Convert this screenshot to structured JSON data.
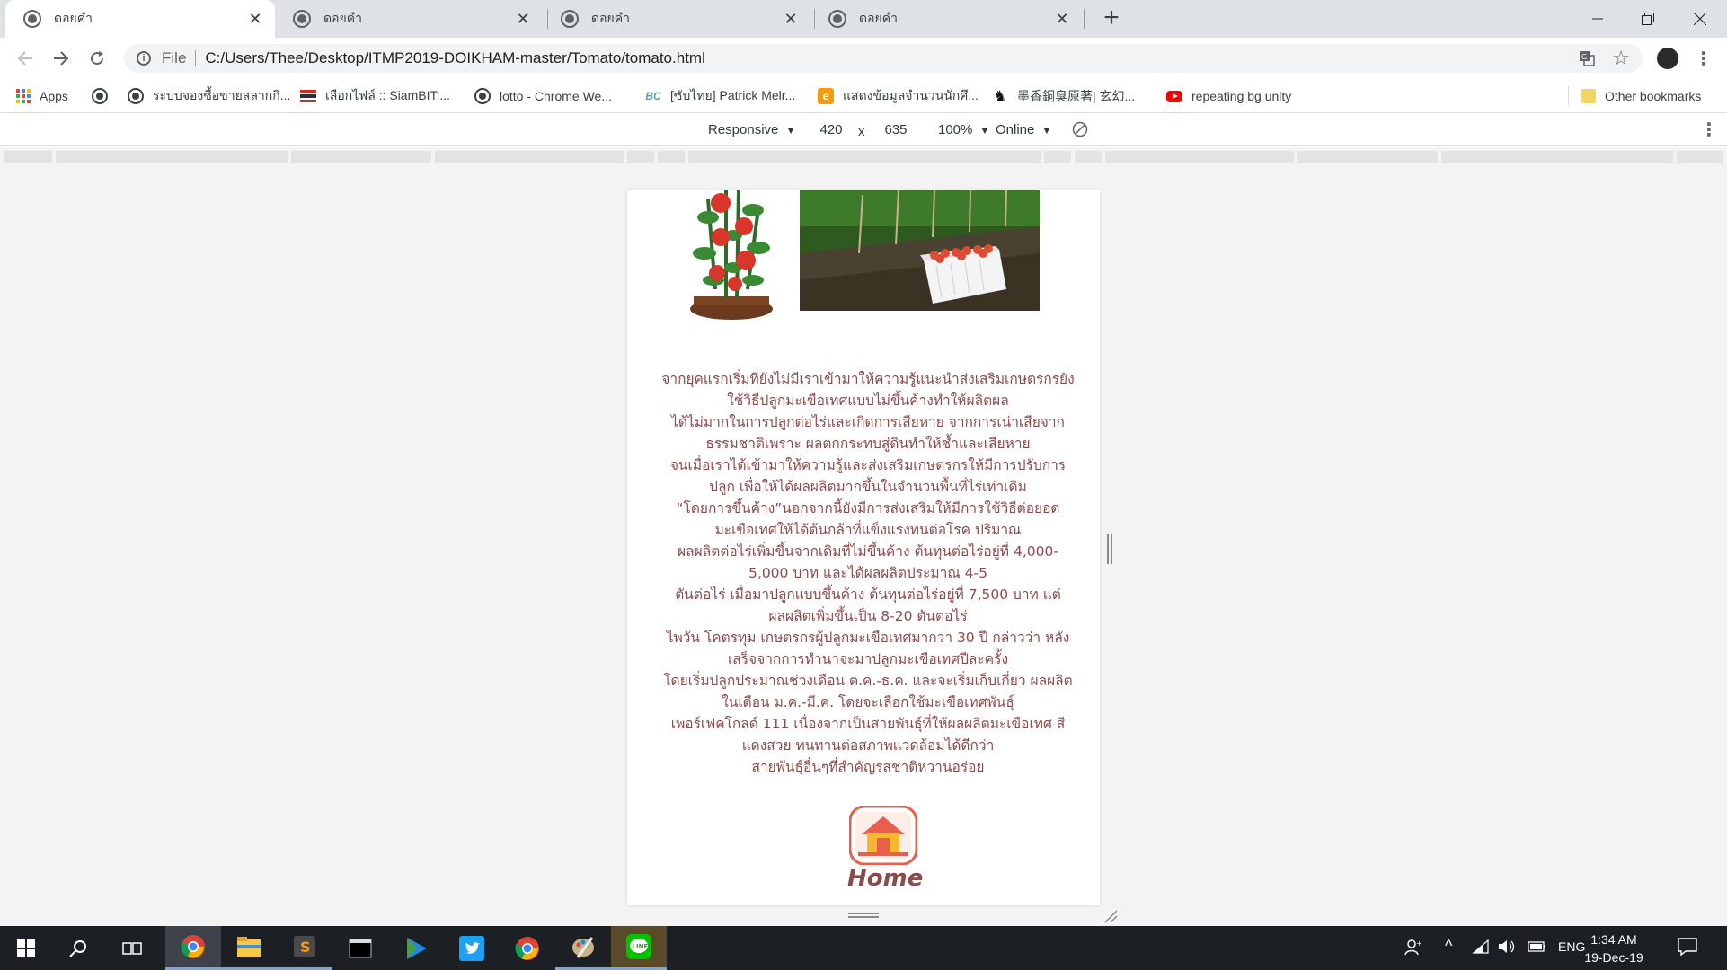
{
  "browser": {
    "tabs": [
      {
        "title": "ดอยคำ",
        "active": true
      },
      {
        "title": "ดอยคำ",
        "active": false
      },
      {
        "title": "ดอยคำ",
        "active": false
      },
      {
        "title": "ดอยคำ",
        "active": false
      }
    ],
    "address": {
      "scheme_label": "File",
      "url": "C:/Users/Thee/Desktop/ITMP2019-DOIKHAM-master/Tomato/tomato.html"
    }
  },
  "bookmarks": {
    "items": [
      {
        "label": "Apps",
        "icon": "apps-icon"
      },
      {
        "label": "",
        "icon": "globe-icon"
      },
      {
        "label": "ระบบจองซื้อขายสลากกิ...",
        "icon": "globe-icon"
      },
      {
        "label": "เลือกไฟล์ :: SiamBIT:...",
        "icon": "thai-flag-icon"
      },
      {
        "label": "lotto - Chrome We...",
        "icon": "globe-icon"
      },
      {
        "label": "[ซับไทย] Patrick Melr...",
        "icon": "bc-icon"
      },
      {
        "label": "แสดงข้อมูลจำนวนนักศึ...",
        "icon": "orange-app-icon"
      },
      {
        "label": "墨香銅臭原著| 玄幻...",
        "icon": "fox-icon"
      },
      {
        "label": "repeating bg unity",
        "icon": "youtube-icon"
      }
    ],
    "other_label": "Other bookmarks"
  },
  "devtools": {
    "device": "Responsive",
    "width": "420",
    "times": "x",
    "height": "635",
    "zoom": "100%",
    "network": "Online"
  },
  "page": {
    "story_lines": [
      "จากยุคแรกเริ่มที่ยังไม่มีเราเข้ามาให้ความรู้แนะนำส่งเสริมเกษตรกรยัง",
      "ใช้วิธีปลูกมะเขือเทศแบบไม่ขึ้นค้างทำให้ผลิตผล",
      "ได้ไม่มากในการปลูกต่อไร่และเกิดการเสียหาย จากการเน่าเสียจาก",
      "ธรรมชาติเพราะ ผลตกกระทบสู่ดินทำให้ช้ำและเสียหาย",
      "จนเมื่อเราได้เข้ามาให้ความรู้และส่งเสริมเกษตรกรให้มีการปรับการ",
      "ปลูก เพื่อให้ได้ผลผลิตมากขึ้นในจำนวนพื้นที่ไร่เท่าเดิม",
      "“โดยการขึ้นค้าง”นอกจากนี้ยังมีการส่งเสริมให้มีการใช้วิธีต่อยอด",
      "มะเขือเทศให้ได้ต้นกล้าที่แข็งแรงทนต่อโรค ปริมาณ",
      "ผลผลิตต่อไร่เพิ่มขึ้นจากเดิมที่ไม่ขึ้นค้าง ต้นทุนต่อไร่อยู่ที่ 4,000-",
      "5,000 บาท และได้ผลผลิตประมาณ 4-5",
      "ตันต่อไร่ เมื่อมาปลูกแบบขึ้นค้าง ต้นทุนต่อไร่อยู่ที่ 7,500 บาท แต่",
      "ผลผลิตเพิ่มขึ้นเป็น 8-20 ตันต่อไร่",
      "ไพวัน โคตรทุม เกษตรกรผู้ปลูกมะเขือเทศมากว่า 30 ปี กล่าวว่า หลัง",
      "เสร็จจากการทำนาจะมาปลูกมะเขือเทศปีละครั้ง",
      "โดยเริ่มปลูกประมาณช่วงเดือน ต.ค.-ธ.ค. และจะเริ่มเก็บเกี่ยว ผลผลิต",
      "ในเดือน ม.ค.-มี.ค. โดยจะเลือกใช้มะเขือเทศพันธุ์",
      "เพอร์เฟคโกลด์ 111 เนื่องจากเป็นสายพันธุ์ที่ให้ผลผลิตมะเขือเทศ สี",
      "แดงสวย ทนทานต่อสภาพแวดล้อมได้ดีกว่า",
      "สายพันธุ์อื่นๆที่สำคัญรสชาติหวานอร่อย"
    ],
    "home_label": "Home"
  },
  "taskbar": {
    "language": "ENG",
    "time": "1:34 AM",
    "date": "19-Dec-19"
  },
  "colors": {
    "story_text": "#8b4b4b",
    "tab_strip": "#dee1e6",
    "taskbar": "#1c1f24",
    "home_icon": "#e8604c"
  }
}
